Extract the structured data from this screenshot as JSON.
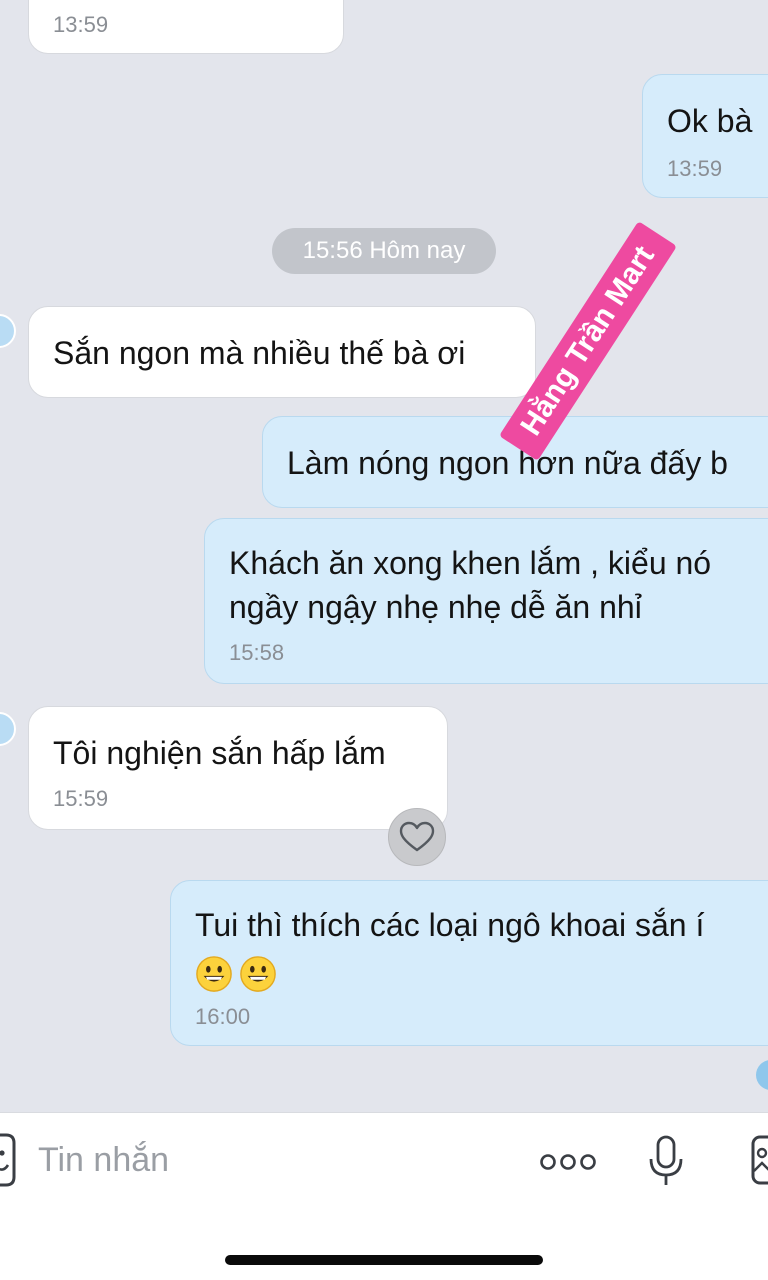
{
  "watermark": "Hằng Trần Mart",
  "date_separator": "15:56 Hôm nay",
  "messages": [
    {
      "side": "incoming",
      "text": "",
      "time": "13:59"
    },
    {
      "side": "outgoing",
      "text": "Ok bà",
      "time": "13:59"
    },
    {
      "side": "incoming",
      "text": "Sắn ngon mà nhiều thế bà ơi",
      "time": ""
    },
    {
      "side": "outgoing",
      "text": "Làm nóng ngon hơn nữa đấy b",
      "time": ""
    },
    {
      "side": "outgoing",
      "lines": [
        "Khách ăn xong khen lắm , kiểu nó",
        "ngầy ngậy  nhẹ nhẹ dễ ăn nhỉ"
      ],
      "time": "15:58"
    },
    {
      "side": "incoming",
      "text": "Tôi nghiện sắn hấp lắm",
      "time": "15:59"
    },
    {
      "side": "outgoing",
      "text": "Tui thì thích các loại ngô khoai sắn í",
      "emojis": [
        "grinning-face-emoji",
        "grinning-face-emoji"
      ],
      "time": "16:00"
    }
  ],
  "composer": {
    "placeholder": "Tin nhắn",
    "icons": [
      "more-icon",
      "microphone-icon",
      "image-icon",
      "sticker-icon"
    ]
  },
  "colors": {
    "background": "#e3e5ec",
    "incoming_bubble": "#ffffff",
    "outgoing_bubble": "#d6ecfb",
    "watermark": "#ee4aa0"
  }
}
